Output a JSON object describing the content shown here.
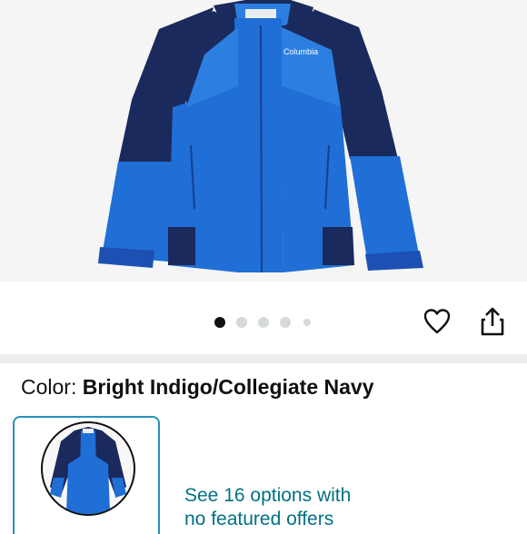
{
  "product": {
    "brand_logo_text": "Columbia",
    "image_colors": {
      "primary": "#1f6fd6",
      "secondary": "#1b2a5c",
      "background": "#f5f5f5"
    }
  },
  "carousel": {
    "total_images": 5,
    "active_index": 0
  },
  "actions": {
    "favorite_icon": "heart-outline-icon",
    "share_icon": "share-icon"
  },
  "color_selector": {
    "label": "Color:",
    "value": "Bright Indigo/Collegiate Navy"
  },
  "offers": {
    "line1": "See 16 options with",
    "line2": "no featured offers"
  },
  "theme": {
    "link_color": "#007185",
    "selected_border": "#2a8fbd",
    "divider_color": "#ededed"
  }
}
